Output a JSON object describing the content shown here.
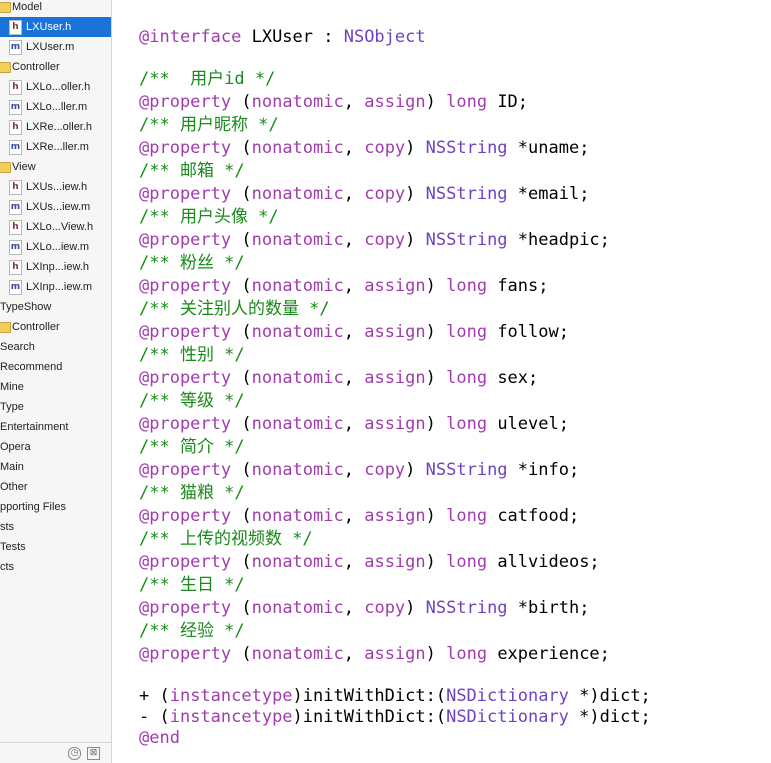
{
  "navigator": {
    "rows": [
      {
        "kind": "folder",
        "label": "Model"
      },
      {
        "kind": "file",
        "badge": "h",
        "label": "LXUser.h",
        "selected": true
      },
      {
        "kind": "file",
        "badge": "m",
        "label": "LXUser.m"
      },
      {
        "kind": "folder",
        "label": "Controller"
      },
      {
        "kind": "file",
        "badge": "h",
        "label": "LXLo...oller.h"
      },
      {
        "kind": "file",
        "badge": "m",
        "label": "LXLo...ller.m"
      },
      {
        "kind": "file",
        "badge": "h",
        "label": "LXRe...oller.h"
      },
      {
        "kind": "file",
        "badge": "m",
        "label": "LXRe...ller.m"
      },
      {
        "kind": "folder",
        "label": "View"
      },
      {
        "kind": "file",
        "badge": "h",
        "label": "LXUs...iew.h"
      },
      {
        "kind": "file",
        "badge": "m",
        "label": "LXUs...iew.m"
      },
      {
        "kind": "file",
        "badge": "h",
        "label": "LXLo...View.h"
      },
      {
        "kind": "file",
        "badge": "m",
        "label": "LXLo...iew.m"
      },
      {
        "kind": "file",
        "badge": "h",
        "label": "LXInp...iew.h"
      },
      {
        "kind": "file",
        "badge": "m",
        "label": "LXInp...iew.m"
      },
      {
        "kind": "group",
        "label": "TypeShow"
      },
      {
        "kind": "folder",
        "label": "Controller"
      },
      {
        "kind": "group",
        "label": "Search"
      },
      {
        "kind": "group",
        "label": "Recommend"
      },
      {
        "kind": "group",
        "label": "Mine"
      },
      {
        "kind": "group",
        "label": "Type"
      },
      {
        "kind": "group",
        "label": "Entertainment"
      },
      {
        "kind": "group",
        "label": "Opera"
      },
      {
        "kind": "group",
        "label": "Main"
      },
      {
        "kind": "group",
        "label": "Other"
      },
      {
        "kind": "group",
        "label": "pporting Files"
      },
      {
        "kind": "group",
        "label": "sts"
      },
      {
        "kind": "group",
        "label": "Tests"
      },
      {
        "kind": "group",
        "label": "cts"
      }
    ],
    "bottom_icons": [
      "clock-icon",
      "filter-icon"
    ]
  },
  "editor": {
    "colors": {
      "keyword": "#a13bae",
      "class": "#6f42c1",
      "comment": "#1a8a1a",
      "plain": "#000000"
    },
    "lines": [
      {
        "t": 26,
        "tokens": [
          {
            "c": "kw",
            "s": "@interface"
          },
          {
            "c": "pl",
            "s": " LXUser : "
          },
          {
            "c": "cls",
            "s": "NSObject"
          }
        ]
      },
      {
        "t": 68,
        "tokens": [
          {
            "c": "cmt",
            "s": "/**  用户id */"
          }
        ]
      },
      {
        "t": 91,
        "tokens": [
          {
            "c": "kw",
            "s": "@property"
          },
          {
            "c": "pl",
            "s": " ("
          },
          {
            "c": "kw",
            "s": "nonatomic"
          },
          {
            "c": "pl",
            "s": ", "
          },
          {
            "c": "kw",
            "s": "assign"
          },
          {
            "c": "pl",
            "s": ") "
          },
          {
            "c": "kw",
            "s": "long"
          },
          {
            "c": "pl",
            "s": " ID;"
          }
        ]
      },
      {
        "t": 114,
        "tokens": [
          {
            "c": "cmt",
            "s": "/** 用户昵称 */"
          }
        ]
      },
      {
        "t": 137,
        "tokens": [
          {
            "c": "kw",
            "s": "@property"
          },
          {
            "c": "pl",
            "s": " ("
          },
          {
            "c": "kw",
            "s": "nonatomic"
          },
          {
            "c": "pl",
            "s": ", "
          },
          {
            "c": "kw",
            "s": "copy"
          },
          {
            "c": "pl",
            "s": ") "
          },
          {
            "c": "cls",
            "s": "NSString"
          },
          {
            "c": "pl",
            "s": " *uname;"
          }
        ]
      },
      {
        "t": 160,
        "tokens": [
          {
            "c": "cmt",
            "s": "/** 邮箱 */"
          }
        ]
      },
      {
        "t": 183,
        "tokens": [
          {
            "c": "kw",
            "s": "@property"
          },
          {
            "c": "pl",
            "s": " ("
          },
          {
            "c": "kw",
            "s": "nonatomic"
          },
          {
            "c": "pl",
            "s": ", "
          },
          {
            "c": "kw",
            "s": "copy"
          },
          {
            "c": "pl",
            "s": ") "
          },
          {
            "c": "cls",
            "s": "NSString"
          },
          {
            "c": "pl",
            "s": " *email;"
          }
        ]
      },
      {
        "t": 206,
        "tokens": [
          {
            "c": "cmt",
            "s": "/** 用户头像 */"
          }
        ]
      },
      {
        "t": 229,
        "tokens": [
          {
            "c": "kw",
            "s": "@property"
          },
          {
            "c": "pl",
            "s": " ("
          },
          {
            "c": "kw",
            "s": "nonatomic"
          },
          {
            "c": "pl",
            "s": ", "
          },
          {
            "c": "kw",
            "s": "copy"
          },
          {
            "c": "pl",
            "s": ") "
          },
          {
            "c": "cls",
            "s": "NSString"
          },
          {
            "c": "pl",
            "s": " *headpic;"
          }
        ]
      },
      {
        "t": 252,
        "tokens": [
          {
            "c": "cmt",
            "s": "/** 粉丝 */"
          }
        ]
      },
      {
        "t": 275,
        "tokens": [
          {
            "c": "kw",
            "s": "@property"
          },
          {
            "c": "pl",
            "s": " ("
          },
          {
            "c": "kw",
            "s": "nonatomic"
          },
          {
            "c": "pl",
            "s": ", "
          },
          {
            "c": "kw",
            "s": "assign"
          },
          {
            "c": "pl",
            "s": ") "
          },
          {
            "c": "kw",
            "s": "long"
          },
          {
            "c": "pl",
            "s": " fans;"
          }
        ]
      },
      {
        "t": 298,
        "tokens": [
          {
            "c": "cmt",
            "s": "/** 关注别人的数量 */"
          }
        ]
      },
      {
        "t": 321,
        "tokens": [
          {
            "c": "kw",
            "s": "@property"
          },
          {
            "c": "pl",
            "s": " ("
          },
          {
            "c": "kw",
            "s": "nonatomic"
          },
          {
            "c": "pl",
            "s": ", "
          },
          {
            "c": "kw",
            "s": "assign"
          },
          {
            "c": "pl",
            "s": ") "
          },
          {
            "c": "kw",
            "s": "long"
          },
          {
            "c": "pl",
            "s": " follow;"
          }
        ]
      },
      {
        "t": 344,
        "tokens": [
          {
            "c": "cmt",
            "s": "/** 性别 */"
          }
        ]
      },
      {
        "t": 367,
        "tokens": [
          {
            "c": "kw",
            "s": "@property"
          },
          {
            "c": "pl",
            "s": " ("
          },
          {
            "c": "kw",
            "s": "nonatomic"
          },
          {
            "c": "pl",
            "s": ", "
          },
          {
            "c": "kw",
            "s": "assign"
          },
          {
            "c": "pl",
            "s": ") "
          },
          {
            "c": "kw",
            "s": "long"
          },
          {
            "c": "pl",
            "s": " sex;"
          }
        ]
      },
      {
        "t": 390,
        "tokens": [
          {
            "c": "cmt",
            "s": "/** 等级 */"
          }
        ]
      },
      {
        "t": 413,
        "tokens": [
          {
            "c": "kw",
            "s": "@property"
          },
          {
            "c": "pl",
            "s": " ("
          },
          {
            "c": "kw",
            "s": "nonatomic"
          },
          {
            "c": "pl",
            "s": ", "
          },
          {
            "c": "kw",
            "s": "assign"
          },
          {
            "c": "pl",
            "s": ") "
          },
          {
            "c": "kw",
            "s": "long"
          },
          {
            "c": "pl",
            "s": " ulevel;"
          }
        ]
      },
      {
        "t": 436,
        "tokens": [
          {
            "c": "cmt",
            "s": "/** 简介 */"
          }
        ]
      },
      {
        "t": 459,
        "tokens": [
          {
            "c": "kw",
            "s": "@property"
          },
          {
            "c": "pl",
            "s": " ("
          },
          {
            "c": "kw",
            "s": "nonatomic"
          },
          {
            "c": "pl",
            "s": ", "
          },
          {
            "c": "kw",
            "s": "copy"
          },
          {
            "c": "pl",
            "s": ") "
          },
          {
            "c": "cls",
            "s": "NSString"
          },
          {
            "c": "pl",
            "s": " *info;"
          }
        ]
      },
      {
        "t": 482,
        "tokens": [
          {
            "c": "cmt",
            "s": "/** 猫粮 */"
          }
        ]
      },
      {
        "t": 505,
        "tokens": [
          {
            "c": "kw",
            "s": "@property"
          },
          {
            "c": "pl",
            "s": " ("
          },
          {
            "c": "kw",
            "s": "nonatomic"
          },
          {
            "c": "pl",
            "s": ", "
          },
          {
            "c": "kw",
            "s": "assign"
          },
          {
            "c": "pl",
            "s": ") "
          },
          {
            "c": "kw",
            "s": "long"
          },
          {
            "c": "pl",
            "s": " catfood;"
          }
        ]
      },
      {
        "t": 528,
        "tokens": [
          {
            "c": "cmt",
            "s": "/** 上传的视频数 */"
          }
        ]
      },
      {
        "t": 551,
        "tokens": [
          {
            "c": "kw",
            "s": "@property"
          },
          {
            "c": "pl",
            "s": " ("
          },
          {
            "c": "kw",
            "s": "nonatomic"
          },
          {
            "c": "pl",
            "s": ", "
          },
          {
            "c": "kw",
            "s": "assign"
          },
          {
            "c": "pl",
            "s": ") "
          },
          {
            "c": "kw",
            "s": "long"
          },
          {
            "c": "pl",
            "s": " allvideos;"
          }
        ]
      },
      {
        "t": 574,
        "tokens": [
          {
            "c": "cmt",
            "s": "/** 生日 */"
          }
        ]
      },
      {
        "t": 597,
        "tokens": [
          {
            "c": "kw",
            "s": "@property"
          },
          {
            "c": "pl",
            "s": " ("
          },
          {
            "c": "kw",
            "s": "nonatomic"
          },
          {
            "c": "pl",
            "s": ", "
          },
          {
            "c": "kw",
            "s": "copy"
          },
          {
            "c": "pl",
            "s": ") "
          },
          {
            "c": "cls",
            "s": "NSString"
          },
          {
            "c": "pl",
            "s": " *birth;"
          }
        ]
      },
      {
        "t": 620,
        "tokens": [
          {
            "c": "cmt",
            "s": "/** 经验 */"
          }
        ]
      },
      {
        "t": 643,
        "tokens": [
          {
            "c": "kw",
            "s": "@property"
          },
          {
            "c": "pl",
            "s": " ("
          },
          {
            "c": "kw",
            "s": "nonatomic"
          },
          {
            "c": "pl",
            "s": ", "
          },
          {
            "c": "kw",
            "s": "assign"
          },
          {
            "c": "pl",
            "s": ") "
          },
          {
            "c": "kw",
            "s": "long"
          },
          {
            "c": "pl",
            "s": " experience;"
          }
        ]
      },
      {
        "t": 685,
        "tokens": [
          {
            "c": "pl",
            "s": "+ ("
          },
          {
            "c": "kw",
            "s": "instancetype"
          },
          {
            "c": "pl",
            "s": ")initWithDict:("
          },
          {
            "c": "cls",
            "s": "NSDictionary"
          },
          {
            "c": "pl",
            "s": " *)dict;"
          }
        ]
      },
      {
        "t": 706,
        "tokens": [
          {
            "c": "pl",
            "s": "- ("
          },
          {
            "c": "kw",
            "s": "instancetype"
          },
          {
            "c": "pl",
            "s": ")initWithDict:("
          },
          {
            "c": "cls",
            "s": "NSDictionary"
          },
          {
            "c": "pl",
            "s": " *)dict;"
          }
        ]
      },
      {
        "t": 727,
        "tokens": [
          {
            "c": "kw",
            "s": "@end"
          }
        ]
      }
    ]
  }
}
